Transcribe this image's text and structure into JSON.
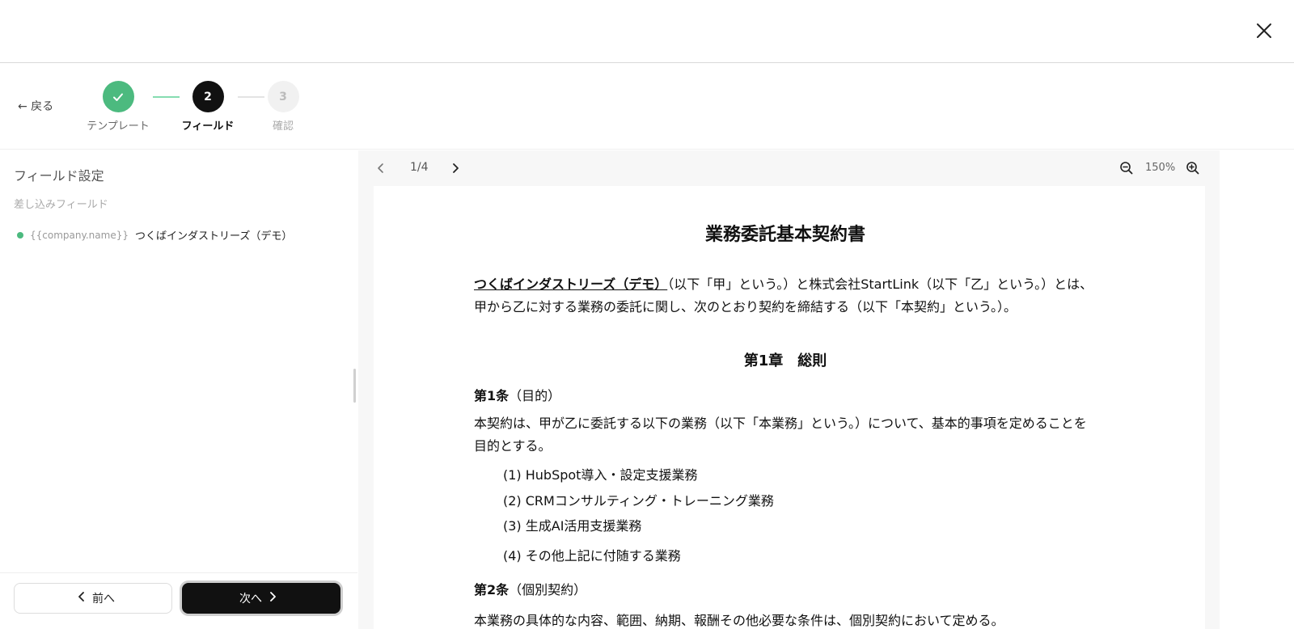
{
  "back_label": "← 戻る",
  "steps": [
    {
      "label": "テンプレート",
      "status": "completed",
      "icon": "check-icon"
    },
    {
      "number": "2",
      "label": "フィールド",
      "status": "current"
    },
    {
      "number": "3",
      "label": "確認",
      "status": "upcoming"
    }
  ],
  "sidebar": {
    "title": "フィールド設定",
    "section_label": "差し込みフィールド",
    "fields": [
      {
        "key": "{{company.name}}",
        "value": "つくばインダストリーズ（デモ）"
      }
    ]
  },
  "footer": {
    "prev_label": "前へ",
    "next_label": "次へ"
  },
  "viewer": {
    "page_indicator": "1/4",
    "zoom": "150%"
  },
  "document": {
    "title": "業務委託基本契約書",
    "intro_company": "つくばインダストリーズ（デモ）",
    "intro_rest": "（以下「甲」という。）と株式会社StartLink（以下「乙」という。）とは、甲から乙に対する業務の委託に関し、次のとおり契約を締結する（以下「本契約」という。）。",
    "chapter": "第1章　総則",
    "article1_num": "第1条",
    "article1_title": "（目的）",
    "article1_body": "本契約は、甲が乙に委託する以下の業務（以下「本業務」という。）について、基本的事項を定めることを目的とする。",
    "items": [
      "(1) HubSpot導入・設定支援業務",
      "(2) CRMコンサルティング・トレーニング業務",
      "(3) 生成AI活用支援業務",
      "(4) その他上記に付随する業務"
    ],
    "article2_num": "第2条",
    "article2_title": "（個別契約）",
    "article2_body": "本業務の具体的な内容、範囲、納期、報酬その他必要な条件は、個別契約において定める。"
  },
  "colors": {
    "success": "#4cba7f",
    "primary": "#111111",
    "connector_done": "#86dcb1"
  }
}
